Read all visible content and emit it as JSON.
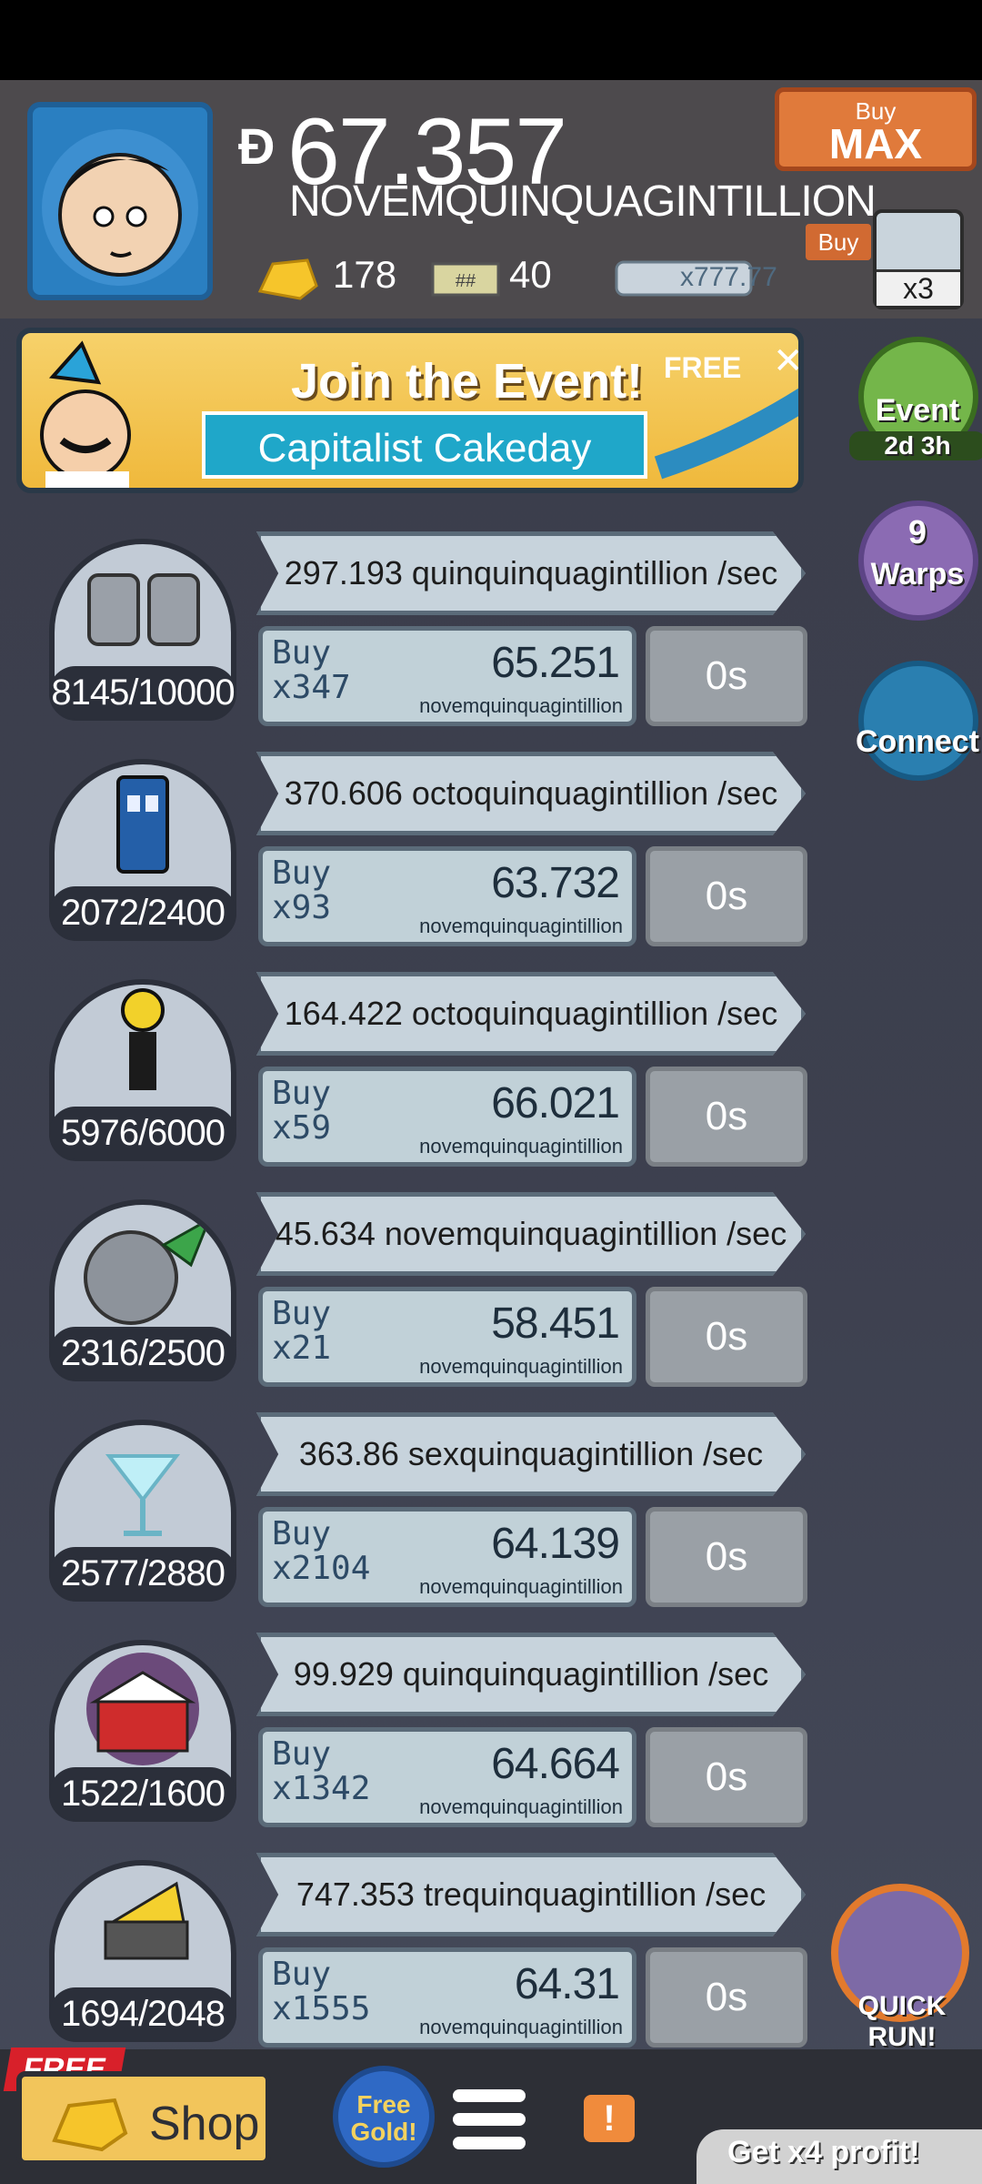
{
  "header": {
    "money_symbol": "Ð",
    "money_value": "67.357",
    "money_unit": "NOVEMQUINQUAGINTILLION",
    "gold_count": "178",
    "tickets_count": "40",
    "mega_value": "x777.77",
    "buy_max_small": "Buy",
    "buy_max_big": "MAX",
    "buy_tag": "Buy",
    "multiplier": "x3"
  },
  "event_banner": {
    "title": "Join the Event!",
    "subtitle": "Capitalist Cakeday",
    "free_label": "FREE",
    "close": "✕"
  },
  "side_buttons": {
    "event": {
      "label": "Event",
      "timer": "2d 3h"
    },
    "warps": {
      "label": "Warps",
      "count": "9"
    },
    "connect": {
      "label": "Connect"
    }
  },
  "businesses": [
    {
      "icon": "moon-boots-icon",
      "count": "8145/10000",
      "rate": "297.193 quinquinquagintillion /sec",
      "buy": "Buy",
      "qty": "x347",
      "cost": "65.251",
      "unit": "novemquinquagintillion",
      "time": "0s"
    },
    {
      "icon": "phone-booth-icon",
      "count": "2072/2400",
      "rate": "370.606 octoquinquagintillion /sec",
      "buy": "Buy",
      "qty": "x93",
      "cost": "63.732",
      "unit": "novemquinquagintillion",
      "time": "0s"
    },
    {
      "icon": "smiley-robot-icon",
      "count": "5976/6000",
      "rate": "164.422 octoquinquagintillion /sec",
      "buy": "Buy",
      "qty": "x59",
      "cost": "66.021",
      "unit": "novemquinquagintillion",
      "time": "0s"
    },
    {
      "icon": "rocket-moon-icon",
      "count": "2316/2500",
      "rate": "45.634 novemquinquagintillion /sec",
      "buy": "Buy",
      "qty": "x21",
      "cost": "58.451",
      "unit": "novemquinquagintillion",
      "time": "0s"
    },
    {
      "icon": "cocktail-icon",
      "count": "2577/2880",
      "rate": "363.86 sexquinquagintillion /sec",
      "buy": "Buy",
      "qty": "x2104",
      "cost": "64.139",
      "unit": "novemquinquagintillion",
      "time": "0s"
    },
    {
      "icon": "barn-icon",
      "count": "1522/1600",
      "rate": "99.929 quinquinquagintillion /sec",
      "buy": "Buy",
      "qty": "x1342",
      "cost": "64.664",
      "unit": "novemquinquagintillion",
      "time": "0s"
    },
    {
      "icon": "cheese-cart-icon",
      "count": "1694/2048",
      "rate": "747.353 trequinquagintillion /sec",
      "buy": "Buy",
      "qty": "x1555",
      "cost": "64.31",
      "unit": "novemquinquagintillion",
      "time": "0s"
    }
  ],
  "quick_run": {
    "label": "QUICK RUN!"
  },
  "bottom": {
    "free_ribbon": "FREE",
    "shop": "Shop",
    "free_gold": "Free Gold!",
    "alert": "!",
    "get_profit": "Get x4 profit!"
  }
}
